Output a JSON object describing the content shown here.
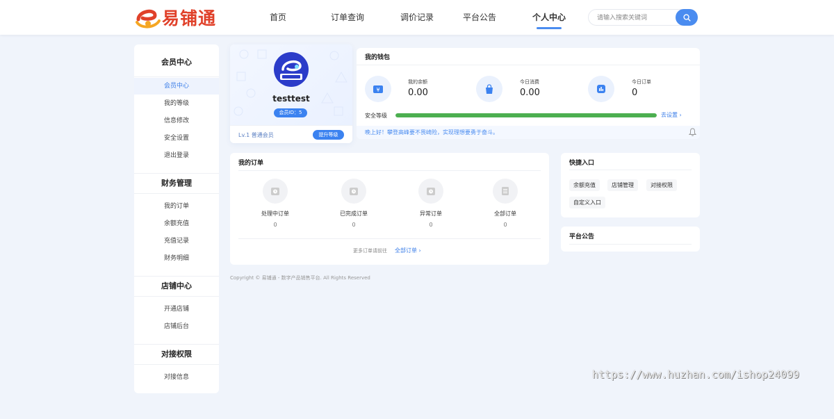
{
  "header": {
    "logo_text": "易铺通",
    "nav": [
      {
        "label": "首页",
        "active": false
      },
      {
        "label": "订单查询",
        "active": false
      },
      {
        "label": "调价记录",
        "active": false
      },
      {
        "label": "平台公告",
        "active": false
      },
      {
        "label": "个人中心",
        "active": true
      }
    ],
    "search_placeholder": "请输入搜索关键词"
  },
  "sidebar": {
    "groups": [
      {
        "title": "会员中心",
        "items": [
          "会员中心",
          "我的等级",
          "信息修改",
          "安全设置",
          "退出登录"
        ]
      },
      {
        "title": "财务管理",
        "items": [
          "我的订单",
          "余额充值",
          "充值记录",
          "财务明细"
        ]
      },
      {
        "title": "店铺中心",
        "items": [
          "开通店铺",
          "店铺后台"
        ]
      },
      {
        "title": "对接权限",
        "items": [
          "对接信息"
        ]
      }
    ],
    "active_item": "会员中心"
  },
  "profile": {
    "username": "testtest",
    "member_id": "会员ID：5",
    "level_text": "Lv.1 普通会员",
    "upgrade_label": "提升等级"
  },
  "wallet": {
    "title": "我的钱包",
    "stats": [
      {
        "label": "我的余额",
        "value": "0.00",
        "icon": "wallet-icon"
      },
      {
        "label": "今日消费",
        "value": "0.00",
        "icon": "shopping-bag-icon"
      },
      {
        "label": "今日订单",
        "value": "0",
        "icon": "chart-icon"
      }
    ],
    "security_label": "安全等级",
    "security_level": 1.0,
    "security_link": "去设置 ›",
    "greeting": "晚上好！攀登高峰要不畏崎险，实现理想要勇于奋斗。"
  },
  "orders": {
    "title": "我的订单",
    "items": [
      {
        "label": "处理中订单",
        "count": "0"
      },
      {
        "label": "已完成订单",
        "count": "0"
      },
      {
        "label": "异常订单",
        "count": "0"
      },
      {
        "label": "全部订单",
        "count": "0"
      }
    ],
    "more_text": "更多订单请前往",
    "more_link": "全部订单 ›"
  },
  "shortcuts": {
    "title": "快捷入口",
    "items": [
      "余额充值",
      "店铺管理",
      "对接权限",
      "自定义入口"
    ]
  },
  "announcement": {
    "title": "平台公告"
  },
  "footer": {
    "copyright": "Copyright © 易铺通 - 数字产品销售平台. All Rights Reserved"
  },
  "watermark": "https://www.huzhan.com/ishop24099",
  "colors": {
    "accent": "#3b82f0",
    "security_bar": "#4caf50",
    "logo": "#e0412a"
  }
}
